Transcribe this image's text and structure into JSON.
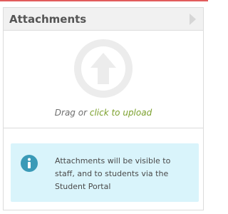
{
  "panel": {
    "title": "Attachments"
  },
  "dropzone": {
    "prefix": "Drag or ",
    "link": "click to upload"
  },
  "info": {
    "text": "Attachments will be visible to staff, and to students via the Student Portal"
  },
  "colors": {
    "top_accent": "#e25c5c",
    "link_green": "#7ba02c",
    "info_background": "#d9f4fb",
    "info_icon": "#3a9ab7"
  },
  "icons": {
    "upload": "upload-arrow-icon",
    "info": "info-icon",
    "collapse": "chevron-right-icon"
  }
}
